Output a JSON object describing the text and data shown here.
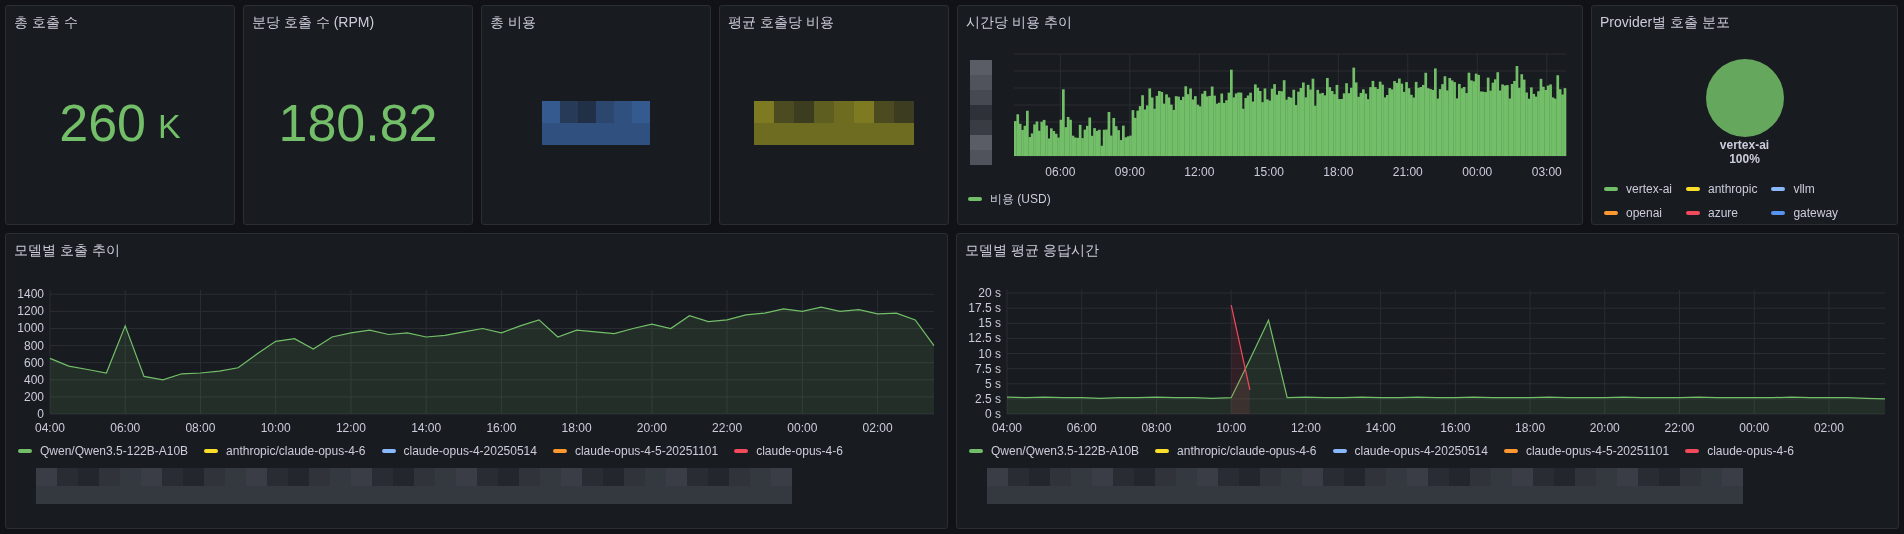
{
  "stats": [
    {
      "title": "총 호출 수",
      "kind": "value",
      "value": "260",
      "unit": "K"
    },
    {
      "title": "분당 호출 수 (RPM)",
      "kind": "value",
      "value": "180.82"
    },
    {
      "title": "총 비용",
      "kind": "masked",
      "color": "#355a90"
    },
    {
      "title": "평균 호출당 비용",
      "kind": "masked",
      "color": "#7d7a22"
    }
  ],
  "cost_trend": {
    "title": "시간당 비용 추이",
    "x_labels": [
      "06:00",
      "09:00",
      "12:00",
      "15:00",
      "18:00",
      "21:00",
      "00:00",
      "03:00"
    ],
    "legend": [
      {
        "name": "비용 (USD)",
        "color": "#73bf69"
      }
    ]
  },
  "provider_distribution": {
    "title": "Provider별 호출 분포",
    "chart_data": {
      "type": "pie",
      "categories": [
        "vertex-ai",
        "anthropic",
        "vllm",
        "openai",
        "azure",
        "gateway"
      ],
      "values": [
        100,
        0,
        0,
        0,
        0,
        0
      ],
      "value_labels": [
        "100%",
        null,
        null,
        null,
        null,
        null
      ]
    },
    "legend": [
      {
        "color": "#73bf69"
      },
      {
        "color": "#fade2a"
      },
      {
        "color": "#8ab8ff"
      },
      {
        "color": "#ff9830"
      },
      {
        "color": "#f2495c"
      },
      {
        "color": "#5794f2"
      }
    ]
  },
  "model_calls": {
    "title": "모델별 호출 추이",
    "chart_data": {
      "type": "area",
      "grid": true,
      "ylim": [
        0,
        1450
      ],
      "categories": [
        "04:00",
        null,
        null,
        null,
        "06:00",
        null,
        null,
        null,
        "08:00",
        null,
        null,
        null,
        "10:00",
        null,
        null,
        null,
        "12:00",
        null,
        null,
        null,
        "14:00",
        null,
        null,
        null,
        "16:00",
        null,
        null,
        null,
        "18:00",
        null,
        null,
        null,
        "20:00",
        null,
        null,
        null,
        "22:00",
        null,
        null,
        null,
        "00:00",
        null,
        null,
        null,
        "02:00",
        null,
        null,
        null
      ],
      "yticks": [
        0,
        200,
        400,
        600,
        800,
        1000,
        1200,
        1400
      ],
      "series": [
        {
          "name": "Qwen/Qwen3.5-122B-A10B",
          "color": "#73bf69",
          "values": [
            650,
            560,
            520,
            480,
            1030,
            440,
            400,
            470,
            480,
            500,
            540,
            700,
            850,
            880,
            760,
            900,
            950,
            980,
            930,
            950,
            900,
            920,
            960,
            1000,
            950,
            1030,
            1100,
            900,
            980,
            960,
            940,
            1000,
            1050,
            1000,
            1150,
            1080,
            1100,
            1160,
            1180,
            1230,
            1200,
            1250,
            1200,
            1220,
            1170,
            1180,
            1100,
            800
          ]
        },
        {
          "name": "anthropic/claude-opus-4-6",
          "color": "#fade2a",
          "values": [
            null,
            null,
            null,
            null,
            null,
            null,
            null,
            null,
            null,
            null,
            null,
            null,
            null,
            null,
            null,
            null,
            null,
            null,
            null,
            null,
            null,
            null,
            null,
            null,
            null,
            null,
            null,
            null,
            null,
            null,
            null,
            null,
            null,
            null,
            null,
            null,
            null,
            null,
            null,
            null,
            null,
            null,
            null,
            null,
            null,
            null,
            null,
            null
          ]
        },
        {
          "name": "claude-opus-4-20250514",
          "color": "#8ab8ff",
          "values": [
            null,
            null,
            null,
            null,
            null,
            null,
            null,
            null,
            null,
            null,
            null,
            null,
            null,
            null,
            null,
            null,
            null,
            null,
            null,
            null,
            null,
            null,
            null,
            null,
            null,
            null,
            null,
            null,
            null,
            null,
            null,
            null,
            null,
            null,
            null,
            null,
            null,
            null,
            null,
            null,
            null,
            null,
            null,
            null,
            null,
            null,
            null,
            null
          ]
        },
        {
          "name": "claude-opus-4-5-20251101",
          "color": "#ff9830",
          "values": [
            null,
            null,
            null,
            null,
            null,
            null,
            null,
            null,
            null,
            null,
            null,
            null,
            null,
            null,
            null,
            null,
            null,
            null,
            null,
            null,
            null,
            null,
            null,
            null,
            null,
            null,
            null,
            null,
            null,
            null,
            null,
            null,
            null,
            null,
            null,
            null,
            null,
            null,
            null,
            null,
            null,
            null,
            null,
            null,
            null,
            null,
            null,
            null
          ]
        },
        {
          "name": "claude-opus-4-6",
          "color": "#f2495c",
          "values": [
            null,
            null,
            null,
            null,
            null,
            null,
            null,
            null,
            null,
            null,
            null,
            null,
            null,
            null,
            null,
            null,
            null,
            null,
            null,
            null,
            null,
            null,
            null,
            null,
            null,
            null,
            null,
            null,
            null,
            null,
            null,
            null,
            null,
            null,
            null,
            null,
            null,
            null,
            null,
            null,
            null,
            null,
            null,
            null,
            null,
            null,
            null,
            null
          ]
        }
      ]
    }
  },
  "response_time": {
    "title": "모델별 평균 응답시간",
    "chart_data": {
      "type": "area",
      "grid": true,
      "ylim": [
        0,
        20.5
      ],
      "categories": [
        "04:00",
        null,
        null,
        null,
        "06:00",
        null,
        null,
        null,
        "08:00",
        null,
        null,
        null,
        "10:00",
        null,
        null,
        null,
        "12:00",
        null,
        null,
        null,
        "14:00",
        null,
        null,
        null,
        "16:00",
        null,
        null,
        null,
        "18:00",
        null,
        null,
        null,
        "20:00",
        null,
        null,
        null,
        "22:00",
        null,
        null,
        null,
        "00:00",
        null,
        null,
        null,
        "02:00",
        null,
        null,
        null
      ],
      "yticks": [
        {
          "value": 0,
          "label": "0 s"
        },
        {
          "value": 2.5,
          "label": "2.5 s"
        },
        {
          "value": 5,
          "label": "5 s"
        },
        {
          "value": 7.5,
          "label": "7.5 s"
        },
        {
          "value": 10,
          "label": "10 s"
        },
        {
          "value": 12.5,
          "label": "12.5 s"
        },
        {
          "value": 15,
          "label": "15 s"
        },
        {
          "value": 17.5,
          "label": "17.5 s"
        },
        {
          "value": 20,
          "label": "20 s"
        }
      ],
      "series": [
        {
          "name": "Qwen/Qwen3.5-122B-A10B",
          "color": "#73bf69",
          "values": [
            2.8,
            2.7,
            2.8,
            2.7,
            2.7,
            2.6,
            2.7,
            2.7,
            2.8,
            2.7,
            2.7,
            2.6,
            2.7,
            9,
            15.5,
            2.7,
            2.8,
            2.7,
            2.7,
            2.8,
            2.7,
            2.7,
            2.8,
            2.7,
            2.7,
            2.8,
            2.7,
            2.7,
            2.7,
            2.8,
            2.7,
            2.7,
            2.7,
            2.8,
            2.7,
            2.7,
            2.7,
            2.8,
            2.7,
            2.7,
            2.7,
            2.7,
            2.8,
            2.7,
            2.7,
            2.7,
            2.6,
            2.5
          ]
        },
        {
          "name": "anthropic/claude-opus-4-6",
          "color": "#fade2a",
          "values": [
            null,
            null,
            null,
            null,
            null,
            null,
            null,
            null,
            null,
            null,
            null,
            null,
            null,
            null,
            null,
            null,
            null,
            null,
            null,
            null,
            null,
            null,
            null,
            null,
            null,
            null,
            null,
            null,
            null,
            null,
            null,
            null,
            null,
            null,
            null,
            null,
            null,
            null,
            null,
            null,
            null,
            null,
            null,
            null,
            null,
            null,
            null,
            null
          ]
        },
        {
          "name": "claude-opus-4-20250514",
          "color": "#8ab8ff",
          "values": [
            null,
            null,
            null,
            null,
            null,
            null,
            null,
            null,
            null,
            null,
            null,
            null,
            null,
            null,
            null,
            null,
            null,
            null,
            null,
            null,
            null,
            null,
            null,
            null,
            null,
            null,
            null,
            null,
            null,
            null,
            null,
            null,
            null,
            null,
            null,
            null,
            null,
            null,
            null,
            null,
            null,
            null,
            null,
            null,
            null,
            null,
            null,
            null
          ]
        },
        {
          "name": "claude-opus-4-5-20251101",
          "color": "#ff9830",
          "values": [
            null,
            null,
            null,
            null,
            null,
            null,
            null,
            null,
            null,
            null,
            null,
            null,
            null,
            null,
            null,
            null,
            null,
            null,
            null,
            null,
            null,
            null,
            null,
            null,
            null,
            null,
            null,
            null,
            null,
            null,
            null,
            null,
            null,
            null,
            null,
            null,
            null,
            null,
            null,
            null,
            null,
            null,
            null,
            null,
            null,
            null,
            null,
            null
          ]
        },
        {
          "name": "claude-opus-4-6",
          "color": "#f2495c",
          "values": [
            null,
            null,
            null,
            null,
            null,
            null,
            null,
            null,
            null,
            null,
            null,
            null,
            18,
            4,
            null,
            null,
            null,
            null,
            null,
            null,
            null,
            null,
            null,
            null,
            null,
            null,
            null,
            null,
            null,
            null,
            null,
            null,
            null,
            null,
            null,
            null,
            null,
            null,
            null,
            null,
            null,
            null,
            null,
            null,
            null,
            null,
            null,
            null
          ]
        }
      ]
    }
  }
}
